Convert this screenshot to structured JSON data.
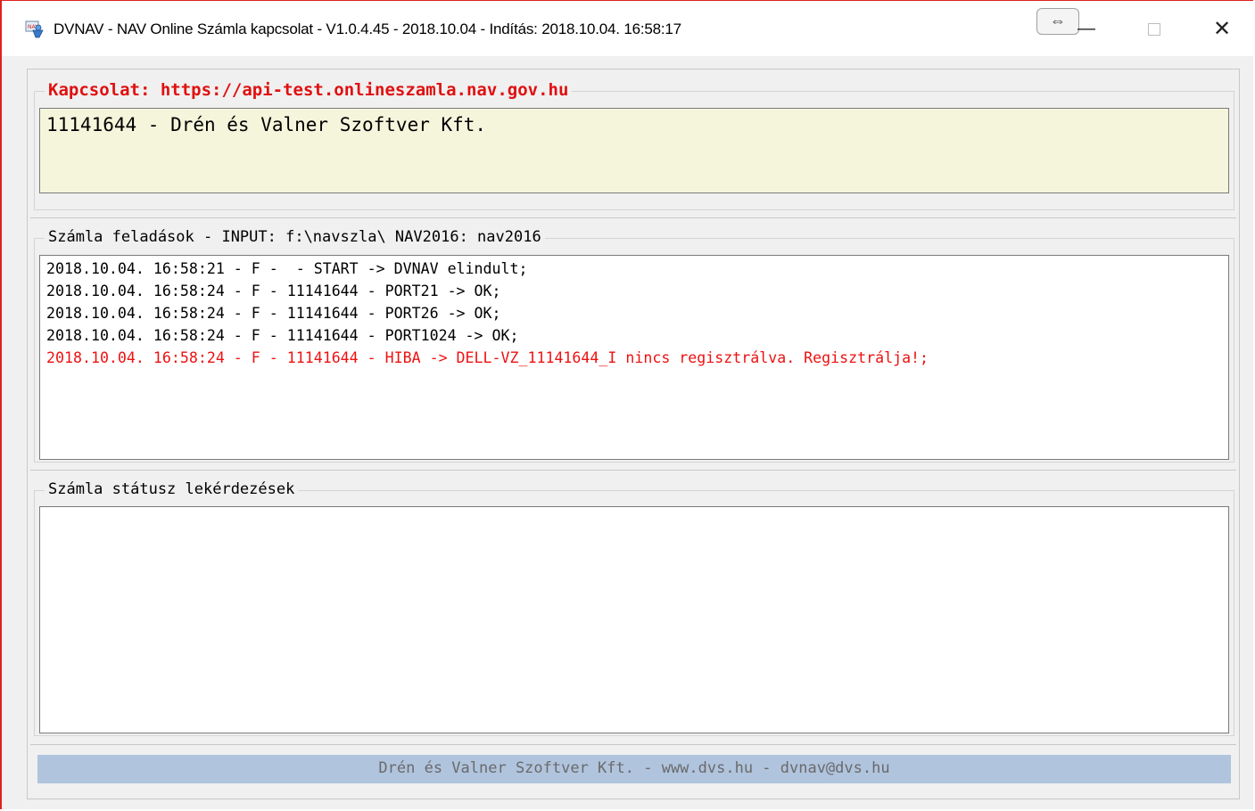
{
  "window": {
    "title": "DVNAV - NAV Online Számla kapcsolat - V1.0.4.45 - 2018.10.04 - Indítás: 2018.10.04. 16:58:17",
    "resize_glyph": "⇔",
    "minimize_glyph": "—",
    "close_glyph": "✕"
  },
  "connection": {
    "legend": "Kapcsolat: https://api-test.onlineszamla.nav.gov.hu",
    "company": "11141644 - Drén és Valner Szoftver Kft."
  },
  "submissions": {
    "legend": "Számla feladások - INPUT: f:\\navszla\\ NAV2016: nav2016",
    "lines": [
      {
        "text": "2018.10.04. 16:58:21 - F -  - START -> DVNAV elindult;",
        "color": "#000000"
      },
      {
        "text": "2018.10.04. 16:58:24 - F - 11141644 - PORT21 -> OK;",
        "color": "#000000"
      },
      {
        "text": "2018.10.04. 16:58:24 - F - 11141644 - PORT26 -> OK;",
        "color": "#000000"
      },
      {
        "text": "2018.10.04. 16:58:24 - F - 11141644 - PORT1024 -> OK;",
        "color": "#000000"
      },
      {
        "text": "2018.10.04. 16:58:24 - F - 11141644 - HIBA -> DELL-VZ_11141644_I nincs regisztrálva. Regisztrálja!;",
        "color": "#ee1111"
      }
    ]
  },
  "status_queries": {
    "legend": "Számla státusz lekérdezések",
    "lines": []
  },
  "footer": {
    "text": "Drén és Valner Szoftver Kft. - www.dvs.hu - dvnav@dvs.hu"
  },
  "colors": {
    "accent_red": "#e01010",
    "company_bg": "#f5f5dc",
    "footer_bg": "#b0c4de",
    "error_text": "#ee1111"
  }
}
